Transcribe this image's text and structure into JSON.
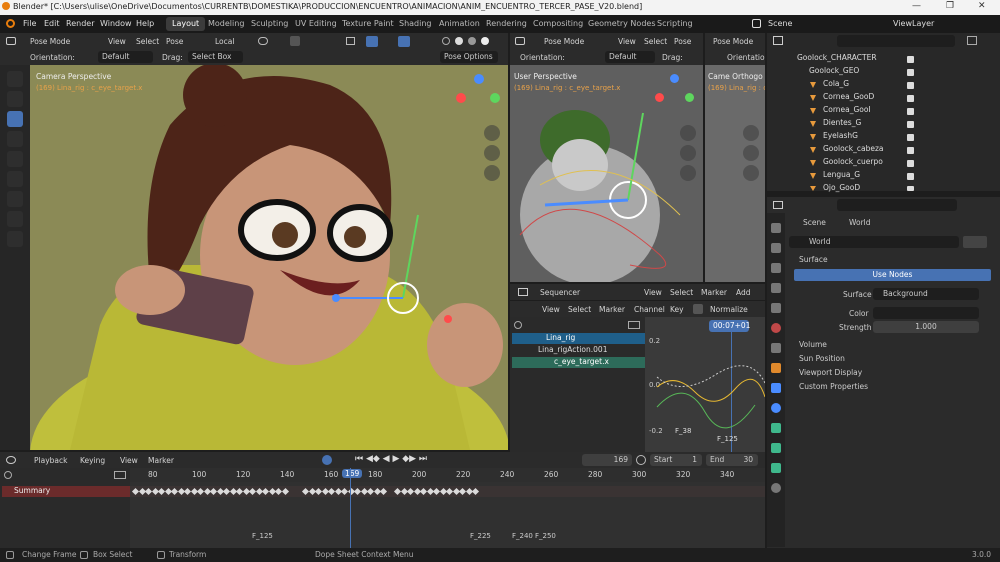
{
  "window": {
    "title": "Blender* [C:\\Users\\ulise\\OneDrive\\Documentos\\CURRENTB\\DOMESTIKA\\PRODUCCION\\ENCUENTRO\\ANIMACION\\ANIM_ENCUENTRO_TERCER_PASE_V20.blend]",
    "controls": [
      "—",
      "❐",
      "✕"
    ]
  },
  "menu": [
    "File",
    "Edit",
    "Render",
    "Window",
    "Help"
  ],
  "workspaces": [
    {
      "label": "Layout",
      "active": true
    },
    {
      "label": "Modeling"
    },
    {
      "label": "Sculpting"
    },
    {
      "label": "UV Editing"
    },
    {
      "label": "Texture Paint"
    },
    {
      "label": "Shading"
    },
    {
      "label": "Animation"
    },
    {
      "label": "Rendering"
    },
    {
      "label": "Compositing"
    },
    {
      "label": "Geometry Nodes"
    },
    {
      "label": "Scripting"
    }
  ],
  "scene": {
    "scene_label": "Scene",
    "viewlayer_label": "ViewLayer"
  },
  "viewport_main": {
    "mode": "Pose Mode",
    "menus": [
      "View",
      "Select",
      "Pose"
    ],
    "transform": "Local",
    "orientation_label": "Orientation:",
    "orientation": "Default",
    "drag_label": "Drag:",
    "drag": "Select Box",
    "pose_options": "Pose Options",
    "view_name": "Camera Perspective",
    "object_info": "(169) Lina_rig : c_eye_target.x"
  },
  "viewport_side": {
    "mode": "Pose Mode",
    "menus": [
      "View",
      "Select",
      "Pose"
    ],
    "orientation_label": "Orientation:",
    "orientation": "Default",
    "drag_label": "Drag:",
    "view_name": "User Perspective",
    "object_info": "(169) Lina_rig : c_eye_target.x"
  },
  "viewport_third": {
    "mode": "Pose Mode",
    "orientation_label": "Orientation:",
    "view_name": "Came   Orthogo",
    "object_info": "(169) Lina_rig : c"
  },
  "outliner": {
    "search_placeholder": "",
    "rows": [
      {
        "label": "Goolock_CHARACTER",
        "indent": 0
      },
      {
        "label": "Goolock_GEO",
        "indent": 1
      },
      {
        "label": "Cola_G",
        "indent": 2
      },
      {
        "label": "Cornea_GooD",
        "indent": 2
      },
      {
        "label": "Cornea_GooI",
        "indent": 2
      },
      {
        "label": "Dientes_G",
        "indent": 2
      },
      {
        "label": "EyelashG",
        "indent": 2
      },
      {
        "label": "Goolock_cabeza",
        "indent": 2
      },
      {
        "label": "Goolock_cuerpo",
        "indent": 2
      },
      {
        "label": "Lengua_G",
        "indent": 2
      },
      {
        "label": "Ojo_GooD",
        "indent": 2
      }
    ]
  },
  "properties": {
    "breadcrumb_scene": "Scene",
    "breadcrumb_world": "World",
    "world_name": "World",
    "surface_panel": "Surface",
    "use_nodes": "Use Nodes",
    "surface_label": "Surface",
    "surface_value": "Background",
    "color_label": "Color",
    "strength_label": "Strength",
    "strength_value": "1.000",
    "panels": [
      "Volume",
      "Sun Position",
      "Viewport Display",
      "Custom Properties"
    ]
  },
  "sequencer": {
    "editor": "Sequencer",
    "menus": [
      "View",
      "Select",
      "Marker"
    ],
    "graph_menus": [
      "View",
      "Select",
      "Marker",
      "Channel",
      "Key"
    ],
    "normalize": "Normalize",
    "time_display": "00:07+01",
    "channels": [
      {
        "label": "Lina_rig",
        "selected": true
      },
      {
        "label": "Lina_rigAction.001",
        "selected": false
      },
      {
        "label": "c_eye_target.x",
        "selected": true
      }
    ],
    "y_labels": [
      "0.2",
      "0.0",
      "-0.2"
    ],
    "markers": [
      "F_38",
      "F_125"
    ],
    "add_menu": "Add"
  },
  "timeline": {
    "menus": [
      "Playback",
      "Keying",
      "View",
      "Marker"
    ],
    "current_frame": "169",
    "start_label": "Start",
    "start": "1",
    "end_label": "End",
    "end": "30",
    "ruler": [
      "80",
      "100",
      "120",
      "140",
      "160",
      "169",
      "180",
      "200",
      "220",
      "240",
      "260",
      "280",
      "300",
      "320",
      "340"
    ],
    "summary": "Summary",
    "markers": [
      "F_125",
      "F_225",
      "F_240",
      "F_250"
    ]
  },
  "status": {
    "left": [
      "Change Frame",
      "Box Select",
      "Transform"
    ],
    "center": "Dope Sheet Context Menu",
    "version": "3.0.0"
  },
  "colors": {
    "accent": "#4772b3",
    "header": "#2b2b2b",
    "viewport_bg": "#8b8a56",
    "selected_channel": "#1f5f8a",
    "playhead": "#4772b3",
    "summary": "#6b2b2b"
  }
}
